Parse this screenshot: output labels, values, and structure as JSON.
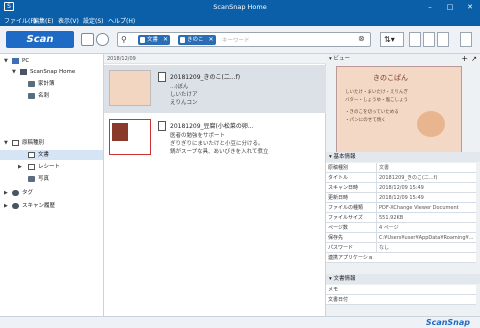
{
  "window": {
    "title": "ScanSnap Home",
    "app_icon": "S"
  },
  "menu": [
    "ファイル(F)",
    "編集(E)",
    "表示(V)",
    "設定(S)",
    "ヘルプ(H)"
  ],
  "toolbar": {
    "scan_label": "Scan",
    "tags": [
      "文書",
      "きのこ"
    ],
    "keyword_placeholder": "キーワード"
  },
  "tree": {
    "pc": "PC",
    "home": "ScanSnap Home",
    "folders": [
      "家計簿",
      "名刺"
    ],
    "doc_types": "原稿種別",
    "types": [
      "文書",
      "レシート",
      "写真"
    ],
    "tag": "タグ",
    "history": "スキャン履歴"
  },
  "list": {
    "date": "2018/12/09",
    "items": [
      {
        "title": "20181209_きのこ(二...f)",
        "lines": [
          "...(ぼん",
          "しいたけア",
          "えりんコン"
        ]
      },
      {
        "title": "20181209_豆腐(小松菜の卵...",
        "lines": [
          "医者の勉強をサポート",
          "ぎりぎりにまいたけと小豆に分ける。",
          "鍋がスープな具、あいびきを入れて煮立"
        ]
      }
    ]
  },
  "preview": {
    "header": "ビュー",
    "doc_title": "きのこぱん",
    "doc_lines": [
      "しいたけ・まいたけ・えりんぎ",
      "バター・しょうゆ・塩こしょう",
      "・きのこを切っていためる",
      "・パンにのせて焼く"
    ]
  },
  "info": {
    "header": "基本情報",
    "rows": [
      {
        "key": "原稿種別",
        "value": "文書"
      },
      {
        "key": "タイトル",
        "value": "20181209_きのこ(二...f)"
      },
      {
        "key": "スキャン日時",
        "value": "2018/12/09 15:49"
      },
      {
        "key": "更新日時",
        "value": "2018/12/09 15:49"
      },
      {
        "key": "ファイルの種類",
        "value": "PDF-XChange Viewer Document"
      },
      {
        "key": "ファイルサイズ",
        "value": "551.92KB"
      },
      {
        "key": "ページ数",
        "value": "4 ページ"
      },
      {
        "key": "保存先",
        "value": "C:¥Users¥user¥AppData¥Roaming¥..."
      },
      {
        "key": "パスワード",
        "value": "なし"
      },
      {
        "key": "連携アプリケーション",
        "value": ""
      }
    ],
    "doc_header": "文書情報",
    "doc_rows": [
      {
        "key": "メモ",
        "value": ""
      },
      {
        "key": "文書日付",
        "value": ""
      }
    ]
  },
  "brand": "ScanSnap"
}
